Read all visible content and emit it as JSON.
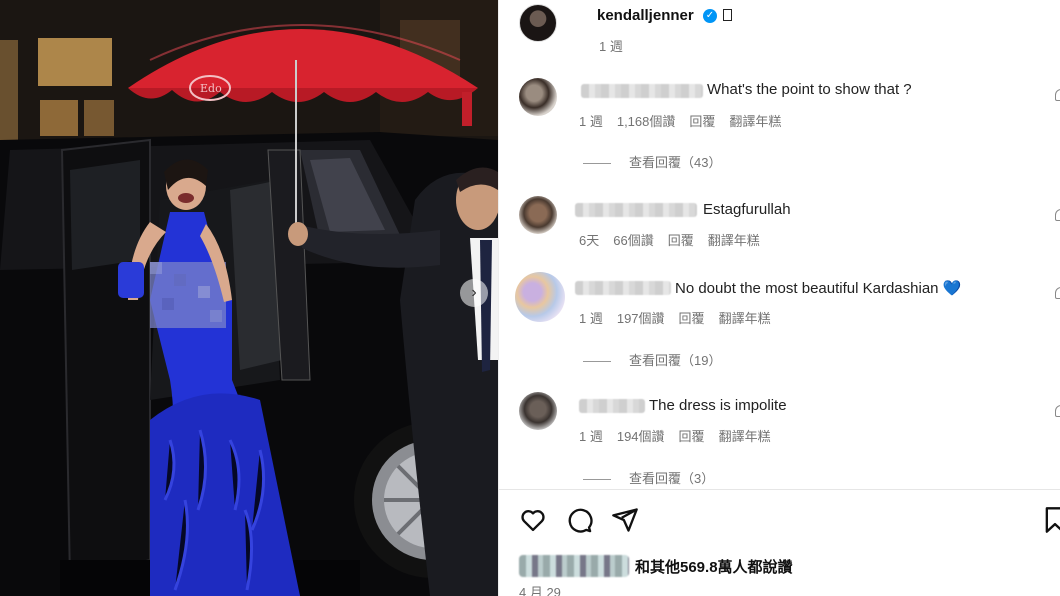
{
  "post": {
    "username": "kendalljenner",
    "verified_mark": "✓",
    "time_ago": "1 週",
    "likes_text": "和其他569.8萬人都說讚",
    "date": "4 月 29"
  },
  "photo": {
    "umbrella_logo": "Edo",
    "carousel_next": "›"
  },
  "comments": [
    {
      "text": "What's the point to show that ?",
      "meta": [
        "1 週",
        "1,168個讚",
        "回覆",
        "翻譯年糕"
      ],
      "view_replies": "查看回覆（43）"
    },
    {
      "text": "Estagfurullah",
      "meta": [
        "6天",
        "66個讚",
        "回覆",
        "翻譯年糕"
      ],
      "view_replies": ""
    },
    {
      "text": "No doubt the most beautiful Kardashian 💙",
      "meta": [
        "1 週",
        "197個讚",
        "回覆",
        "翻譯年糕"
      ],
      "view_replies": "查看回覆（19）"
    },
    {
      "text": "The dress is impolite",
      "meta": [
        "1 週",
        "194個讚",
        "回覆",
        "翻譯年糕"
      ],
      "view_replies": "查看回覆（3）"
    }
  ],
  "icons": [
    "heart-icon",
    "comment-icon",
    "share-icon",
    "bookmark-icon",
    "verified-icon",
    "more-icon"
  ],
  "colors": {
    "umbrella_red": "#d8232f",
    "dress_blue": "#2333d6",
    "verified_blue": "#0095f6",
    "meta_gray": "#737373"
  }
}
